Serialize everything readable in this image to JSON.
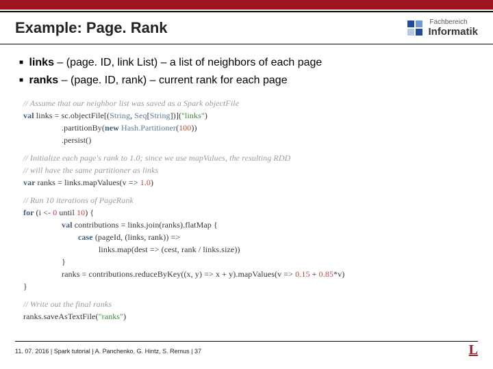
{
  "header": {
    "title": "Example: Page. Rank",
    "logo_top": "Fachbereich",
    "logo_bot": "Informatik"
  },
  "bullets": {
    "b1_term": "links",
    "b1_rest": " – (page. ID, link List) – a list of neighbors of each page",
    "b2_term": "ranks",
    "b2_rest": " – (page. ID, rank) – current rank for each page"
  },
  "code": {
    "c1": "// Assume that our neighbor list was saved as a Spark objectFile",
    "l2_kw": "val ",
    "l2_a": "links = sc.objectFile[(",
    "l2_t1": "String",
    "l2_b": ", ",
    "l2_t2": "Seq",
    "l2_c": "[",
    "l2_t3": "String",
    "l2_d": "])](",
    "l2_s": "\"links\"",
    "l2_e": ")",
    "l3_a": ".partitionBy(",
    "l3_kw": "new ",
    "l3_t": "Hash.Partitioner",
    "l3_b": "(",
    "l3_n": "100",
    "l3_c": "))",
    "l4_a": ".persist()",
    "c5a": "// Initialize each page's rank to 1.0; since we use mapValues, the resulting RDD",
    "c5b": "// will have the same partitioner as links",
    "l6_kw": "var ",
    "l6_a": "ranks = links.mapValues(v => ",
    "l6_n": "1.0",
    "l6_b": ")",
    "c7": "// Run 10 iterations of PageRank",
    "l8_kw": "for ",
    "l8_a": "(i <- ",
    "l8_n1": "0",
    "l8_b": " until ",
    "l8_n2": "10",
    "l8_c": ") {",
    "l9_kw": "val ",
    "l9_a": "contributions = links.join(ranks).flatMap {",
    "l10_kw": "case ",
    "l10_a": "(pageId, (links, rank)) =>",
    "l11_a": "links.map(dest => (cest, rank / links.size))",
    "l12_a": "}",
    "l13_a": "ranks = contributions.reduceByKey((x, y) => x + y).mapValues(v => ",
    "l13_n1": "0.15",
    "l13_b": " + ",
    "l13_n2": "0.85",
    "l13_c": "*v)",
    "l14_a": "}",
    "c15": "// Write out the final ranks",
    "l16_a": "ranks.saveAsTextFile(",
    "l16_s": "\"ranks\"",
    "l16_b": ")"
  },
  "footer": {
    "text": "11. 07. 2016 |  Spark tutorial |  A. Panchenko, G. Hintz, S. Remus  | 37",
    "logo": "L"
  }
}
